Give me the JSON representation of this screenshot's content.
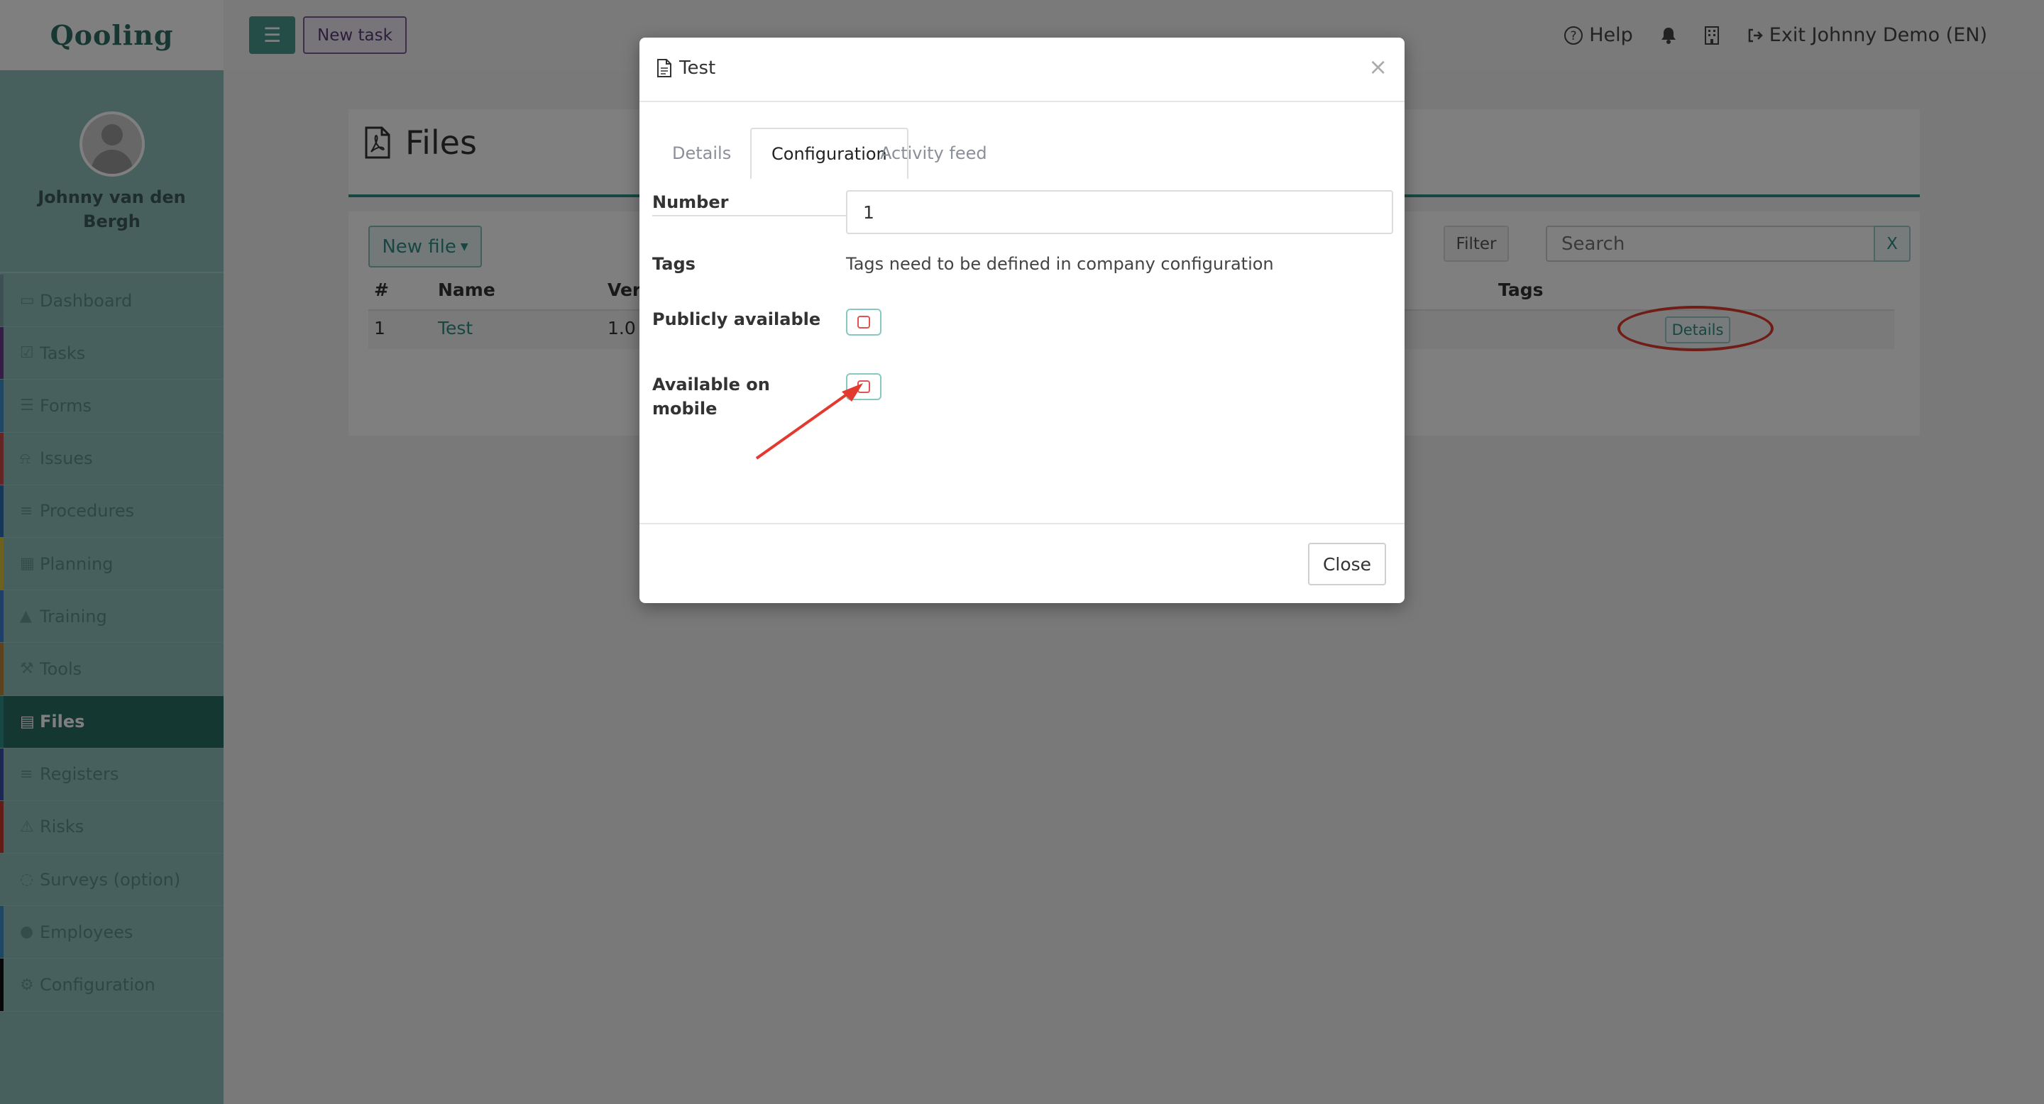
{
  "app": {
    "logo": "Qooling"
  },
  "profile": {
    "name": "Johnny van den Bergh"
  },
  "sidebar": {
    "items": [
      {
        "label": "Dashboard",
        "icon": "monitor-icon",
        "accent": "#7aa0a8",
        "active": false
      },
      {
        "label": "Tasks",
        "icon": "checkbox-icon",
        "accent": "#6a3c8c",
        "active": false
      },
      {
        "label": "Forms",
        "icon": "document-icon",
        "accent": "#3b8fc7",
        "active": false
      },
      {
        "label": "Issues",
        "icon": "bell-icon",
        "accent": "#c94a4a",
        "active": false
      },
      {
        "label": "Procedures",
        "icon": "list-icon",
        "accent": "#2d6fae",
        "active": false
      },
      {
        "label": "Planning",
        "icon": "calendar-icon",
        "accent": "#d9c23a",
        "active": false
      },
      {
        "label": "Training",
        "icon": "graduation-cap-icon",
        "accent": "#3b7fd1",
        "active": false
      },
      {
        "label": "Tools",
        "icon": "wrench-icon",
        "accent": "#b8853a",
        "active": false
      },
      {
        "label": "Files",
        "icon": "pdf-file-icon",
        "accent": "#2f8f87",
        "active": true
      },
      {
        "label": "Registers",
        "icon": "bars-icon",
        "accent": "#3a4fa8",
        "active": false
      },
      {
        "label": "Risks",
        "icon": "warning-icon",
        "accent": "#c8382e",
        "active": false
      },
      {
        "label": "Surveys (option)",
        "icon": "chat-icon",
        "accent": "#8ec1bc",
        "active": false
      },
      {
        "label": "Employees",
        "icon": "users-icon",
        "accent": "#3a8fc7",
        "active": false
      },
      {
        "label": "Configuration",
        "icon": "gear-icon",
        "accent": "#111111",
        "active": false
      }
    ]
  },
  "topbar": {
    "new_task": "New task",
    "help": "Help",
    "exit": "Exit Johnny Demo (EN)"
  },
  "page": {
    "title": "Files",
    "new_file": "New file",
    "filter": "Filter",
    "search_placeholder": "Search",
    "search_clear": "X",
    "table": {
      "headers": {
        "num": "#",
        "name": "Name",
        "version": "Vers",
        "tags": "Tags"
      },
      "rows": [
        {
          "num": "1",
          "name": "Test",
          "version": "1.0",
          "action": "Details"
        }
      ]
    }
  },
  "modal": {
    "title": "Test",
    "close_symbol": "×",
    "tabs": [
      {
        "label": "Details",
        "active": false
      },
      {
        "label": "Configuration",
        "active": true
      },
      {
        "label": "Activity feed",
        "active": false
      }
    ],
    "fields": {
      "number_label": "Number",
      "number_value": "1",
      "tags_label": "Tags",
      "tags_text": "Tags need to be defined in company configuration",
      "public_label": "Publicly available",
      "public_checked": false,
      "mobile_label": "Available on mobile",
      "mobile_checked": false
    },
    "close_button": "Close"
  },
  "colors": {
    "accent": "#2f8f87",
    "annotation": "#e23a2e"
  }
}
